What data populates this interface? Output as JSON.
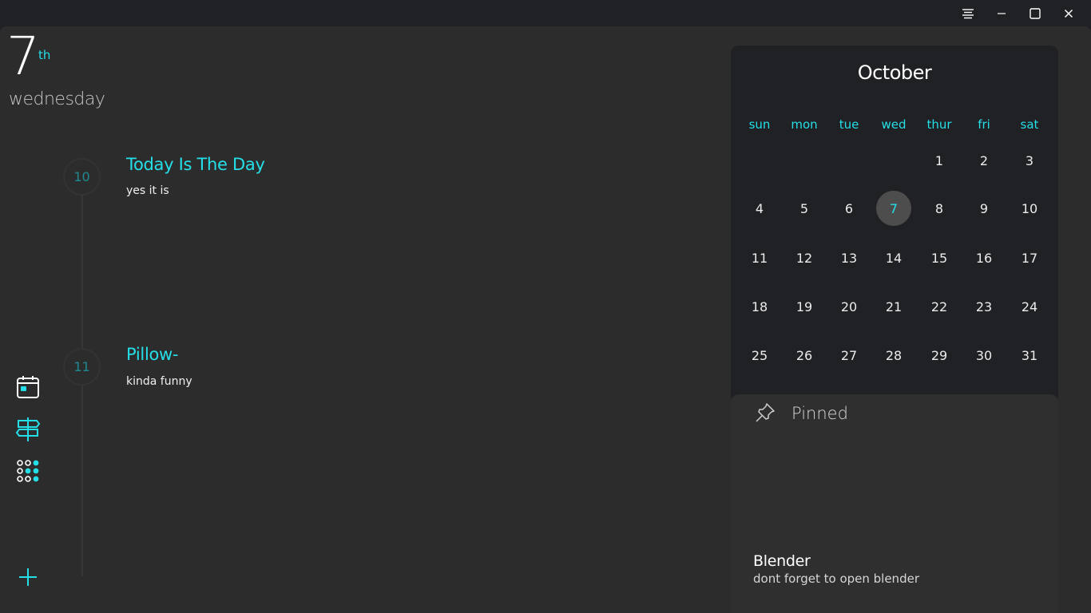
{
  "window": {
    "controls": {
      "menu_icon": "menu-lines-icon",
      "minimize_icon": "minimize-icon",
      "maximize_icon": "maximize-icon",
      "close_icon": "close-icon"
    }
  },
  "header": {
    "day_number": "7",
    "day_suffix": "th",
    "weekday": "wednesday"
  },
  "timeline": {
    "events": [
      {
        "hour": "10",
        "title": "Today Is The Day",
        "description": "yes it is"
      },
      {
        "hour": "11",
        "title": "Pillow-",
        "description": "kinda funny"
      }
    ]
  },
  "sidebar": {
    "items": [
      {
        "icon": "calendar-icon"
      },
      {
        "icon": "signpost-icon"
      },
      {
        "icon": "apps-grid-icon"
      }
    ],
    "add_icon": "add-icon"
  },
  "calendar": {
    "month": "October",
    "weekdays": [
      "sun",
      "mon",
      "tue",
      "wed",
      "thur",
      "fri",
      "sat"
    ],
    "weeks": [
      [
        "",
        "",
        "",
        "",
        "1",
        "2",
        "3"
      ],
      [
        "4",
        "5",
        "6",
        "7",
        "8",
        "9",
        "10"
      ],
      [
        "11",
        "12",
        "13",
        "14",
        "15",
        "16",
        "17"
      ],
      [
        "18",
        "19",
        "20",
        "21",
        "22",
        "23",
        "24"
      ],
      [
        "25",
        "26",
        "27",
        "28",
        "29",
        "30",
        "31"
      ]
    ],
    "selected_day": "7"
  },
  "pinned": {
    "title": "Pinned",
    "icon": "pin-icon",
    "items": [
      {
        "title": "Blender",
        "description": "dont forget to open blender"
      }
    ]
  },
  "colors": {
    "accent": "#25dfe8",
    "panel": "#2c2c2c",
    "card": "#202124"
  }
}
